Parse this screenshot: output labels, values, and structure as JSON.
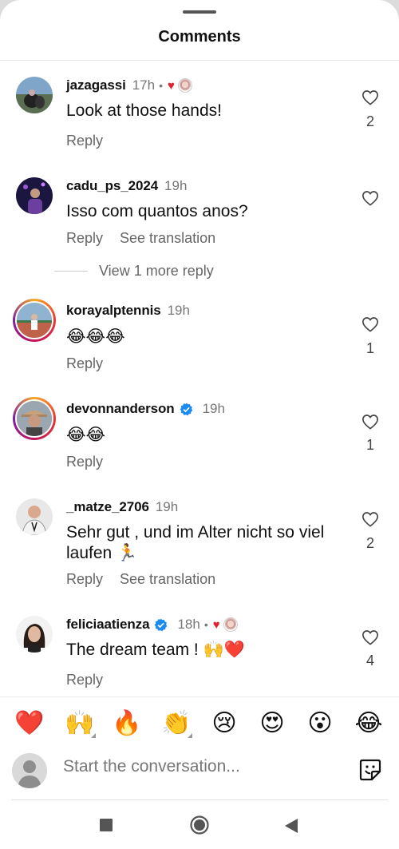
{
  "header": {
    "title": "Comments"
  },
  "comments": [
    {
      "username": "jazagassi",
      "time": "17h",
      "body": "Look at those hands!",
      "like_count": "2",
      "reply_label": "Reply"
    },
    {
      "username": "cadu_ps_2024",
      "time": "19h",
      "body": "Isso com quantos anos?",
      "like_count": "",
      "reply_label": "Reply",
      "translate_label": "See translation"
    },
    {
      "username": "korayalptennis",
      "time": "19h",
      "body": "😂😂😂",
      "like_count": "1",
      "reply_label": "Reply"
    },
    {
      "username": "devonnanderson",
      "time": "19h",
      "body": "😂😂",
      "like_count": "1",
      "reply_label": "Reply"
    },
    {
      "username": "_matze_2706",
      "time": "19h",
      "body": "Sehr gut , und im Alter nicht so viel laufen 🏃",
      "like_count": "2",
      "reply_label": "Reply",
      "translate_label": "See translation"
    },
    {
      "username": "feliciaatienza",
      "time": "18h",
      "body": "The dream team ! 🙌❤️",
      "like_count": "4",
      "reply_label": "Reply"
    }
  ],
  "view_more": {
    "label": "View 1 more reply"
  },
  "reactions": [
    "❤️",
    "🙌",
    "🔥",
    "👏",
    "😢",
    "😍",
    "😮",
    "😂"
  ],
  "composer": {
    "placeholder": "Start the conversation..."
  },
  "colors": {
    "like_red": "#e0242f",
    "verified_blue": "#1a8cf0",
    "secondary_text": "#777777"
  },
  "icons": {
    "like": "heart-outline-icon",
    "verified": "verified-badge-icon",
    "sticker": "sticker-icon",
    "nav_recents": "square-icon",
    "nav_home": "circle-icon",
    "nav_back": "triangle-back-icon"
  }
}
